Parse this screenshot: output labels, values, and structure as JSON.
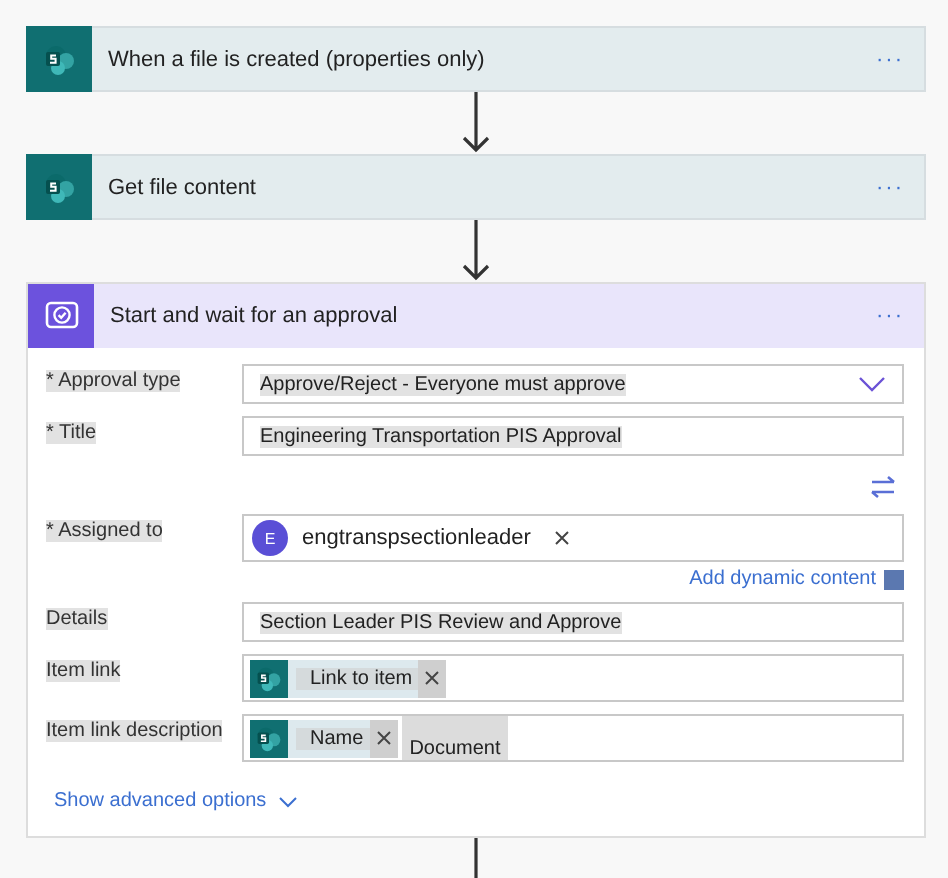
{
  "steps": [
    {
      "kind": "sharepoint",
      "title": "When a file is created (properties only)",
      "menu": "···"
    },
    {
      "kind": "sharepoint",
      "title": "Get file content",
      "menu": "···"
    }
  ],
  "approval": {
    "title": "Start and wait for an approval",
    "menu": "···",
    "fields": [
      {
        "kind": "dropdown",
        "label": "* Approval type",
        "value": "Approve/Reject - Everyone must approve"
      },
      {
        "kind": "text",
        "label": "* Title",
        "value": "Engineering Transportation PIS Approval"
      },
      {
        "kind": "people",
        "label": "* Assigned to",
        "initial": "E",
        "value": "engtranspsectionleader",
        "link": "Add dynamic content"
      },
      {
        "kind": "text",
        "label": "Details",
        "value": "Section Leader PIS Review and Approve"
      },
      {
        "kind": "tokens",
        "label": "Item link",
        "parts": [
          {
            "kind": "token",
            "text": "Link to item"
          }
        ]
      },
      {
        "kind": "tokens",
        "label": "Item link description",
        "parts": [
          {
            "kind": "token",
            "text": "Name"
          },
          {
            "kind": "text",
            "text": "Document"
          }
        ]
      }
    ],
    "advanced": "Show advanced options"
  }
}
